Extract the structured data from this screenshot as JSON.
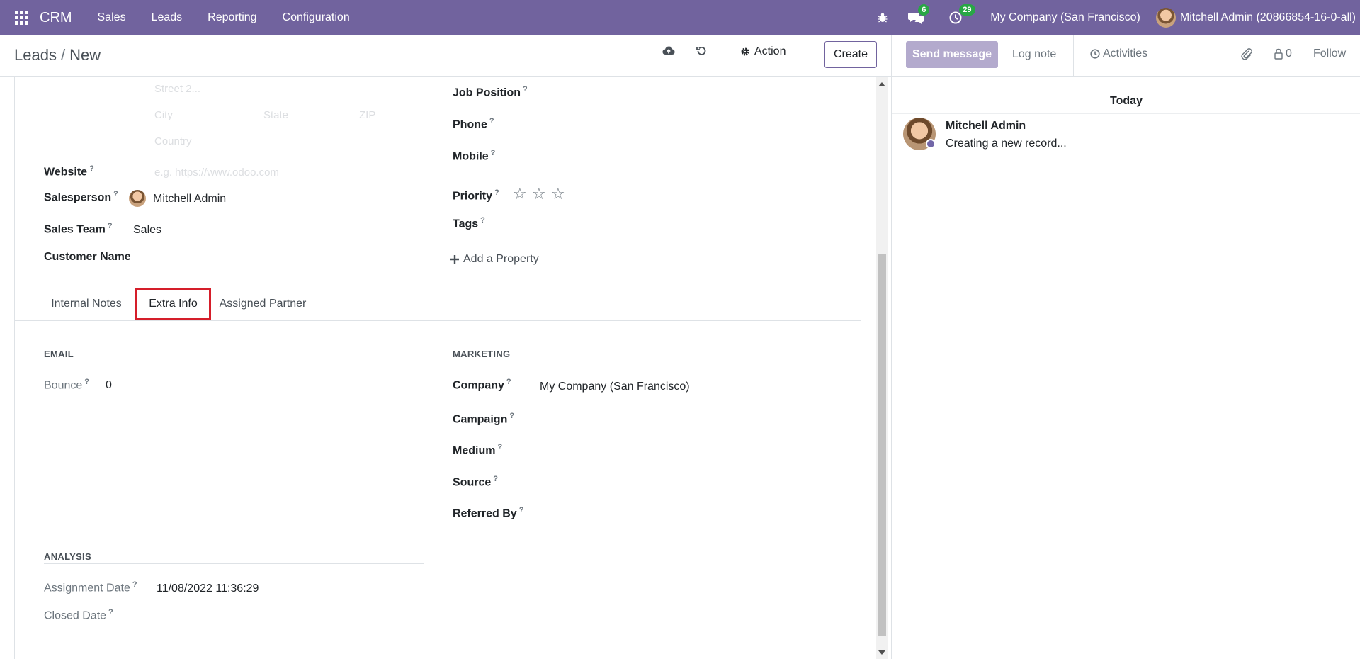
{
  "navbar": {
    "brand": "CRM",
    "menu": [
      "Sales",
      "Leads",
      "Reporting",
      "Configuration"
    ],
    "messages_count": "6",
    "activities_count": "29",
    "company": "My Company (San Francisco)",
    "user": "Mitchell Admin (20866854-16-0-all)",
    "background": "#71639e"
  },
  "control": {
    "breadcrumb_parent": "Leads",
    "breadcrumb_sep": "/",
    "breadcrumb_current": "New",
    "action_label": "Action",
    "create_label": "Create"
  },
  "form": {
    "address": {
      "street2_placeholder": "Street 2...",
      "city_placeholder": "City",
      "state_placeholder": "State",
      "zip_placeholder": "ZIP",
      "country_placeholder": "Country"
    },
    "website": {
      "label": "Website",
      "placeholder": "e.g. https://www.odoo.com"
    },
    "salesperson": {
      "label": "Salesperson",
      "value": "Mitchell Admin"
    },
    "sales_team": {
      "label": "Sales Team",
      "value": "Sales"
    },
    "customer_name": {
      "label": "Customer Name"
    },
    "job_position": {
      "label": "Job Position"
    },
    "phone": {
      "label": "Phone"
    },
    "mobile": {
      "label": "Mobile"
    },
    "priority": {
      "label": "Priority",
      "stars": 3,
      "filled": 0
    },
    "tags": {
      "label": "Tags"
    },
    "add_property": "Add a Property",
    "help_mark": "?"
  },
  "tabs": [
    {
      "label": "Internal Notes",
      "active": false
    },
    {
      "label": "Extra Info",
      "active": true
    },
    {
      "label": "Assigned Partner",
      "active": false
    }
  ],
  "extra_info": {
    "email_title": "EMAIL",
    "bounce": {
      "label": "Bounce",
      "value": "0"
    },
    "analysis_title": "ANALYSIS",
    "assignment_date": {
      "label": "Assignment Date",
      "value": "11/08/2022 11:36:29"
    },
    "closed_date": {
      "label": "Closed Date"
    },
    "marketing_title": "MARKETING",
    "company": {
      "label": "Company",
      "value": "My Company (San Francisco)"
    },
    "campaign": {
      "label": "Campaign"
    },
    "medium": {
      "label": "Medium"
    },
    "source": {
      "label": "Source"
    },
    "referred_by": {
      "label": "Referred By"
    }
  },
  "chatter": {
    "send_message": "Send message",
    "log_note": "Log note",
    "activities": "Activities",
    "followers_count": "0",
    "follow": "Follow",
    "today": "Today",
    "message_author": "Mitchell Admin",
    "message_body": "Creating a new record..."
  }
}
